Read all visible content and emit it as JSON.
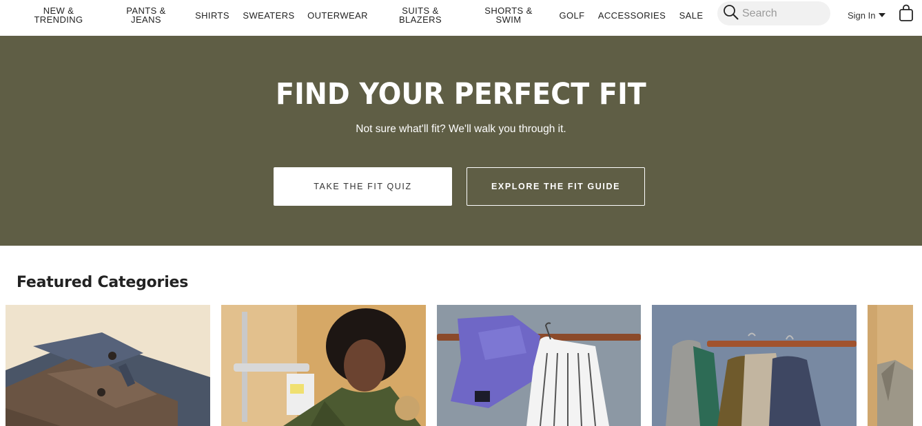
{
  "nav": {
    "items": [
      {
        "label": "NEW &\nTRENDING"
      },
      {
        "label": "PANTS &\nJEANS"
      },
      {
        "label": "SHIRTS"
      },
      {
        "label": "SWEATERS"
      },
      {
        "label": "OUTERWEAR"
      },
      {
        "label": "SUITS &\nBLAZERS"
      },
      {
        "label": "SHORTS &\nSWIM"
      },
      {
        "label": "GOLF"
      },
      {
        "label": "ACCESSORIES"
      },
      {
        "label": "SALE"
      }
    ],
    "search_placeholder": "Search",
    "search_icon": "search-icon",
    "signin_label": "Sign In",
    "bag_icon": "shopping-bag-icon"
  },
  "hero": {
    "title": "FIND YOUR PERFECT FIT",
    "subtitle": "Not sure what'll fit? We'll walk you through it.",
    "primary_button": "TAKE THE FIT QUIZ",
    "secondary_button": "EXPLORE THE FIT GUIDE",
    "background_color": "#5f5e45"
  },
  "featured": {
    "title": "Featured Categories",
    "cards": [
      {
        "image": "pants-photo"
      },
      {
        "image": "model-sweater-photo"
      },
      {
        "image": "shirts-on-rack-photo"
      },
      {
        "image": "jackets-on-rack-photo"
      },
      {
        "image": "blazer-photo"
      }
    ]
  }
}
